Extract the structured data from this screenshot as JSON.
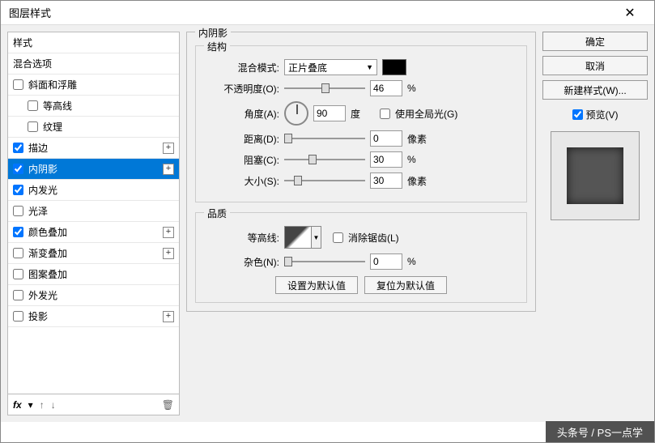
{
  "window": {
    "title": "图层样式"
  },
  "left": {
    "header1": "样式",
    "header2": "混合选项",
    "items": [
      {
        "label": "斜面和浮雕",
        "checked": false,
        "plus": false,
        "indent": 0
      },
      {
        "label": "等高线",
        "checked": false,
        "plus": false,
        "indent": 1
      },
      {
        "label": "纹理",
        "checked": false,
        "plus": false,
        "indent": 1
      },
      {
        "label": "描边",
        "checked": true,
        "plus": true,
        "indent": 0
      },
      {
        "label": "内阴影",
        "checked": true,
        "plus": true,
        "indent": 0,
        "selected": true
      },
      {
        "label": "内发光",
        "checked": true,
        "plus": false,
        "indent": 0
      },
      {
        "label": "光泽",
        "checked": false,
        "plus": false,
        "indent": 0
      },
      {
        "label": "颜色叠加",
        "checked": true,
        "plus": true,
        "indent": 0
      },
      {
        "label": "渐变叠加",
        "checked": false,
        "plus": true,
        "indent": 0
      },
      {
        "label": "图案叠加",
        "checked": false,
        "plus": false,
        "indent": 0
      },
      {
        "label": "外发光",
        "checked": false,
        "plus": false,
        "indent": 0
      },
      {
        "label": "投影",
        "checked": false,
        "plus": true,
        "indent": 0
      }
    ],
    "fx": "fx"
  },
  "mid": {
    "title": "内阴影",
    "struct_title": "结构",
    "blend_mode_label": "混合模式:",
    "blend_mode_value": "正片叠底",
    "opacity_label": "不透明度(O):",
    "opacity_value": "46",
    "opacity_unit": "%",
    "angle_label": "角度(A):",
    "angle_value": "90",
    "angle_unit": "度",
    "global_light_label": "使用全局光(G)",
    "distance_label": "距离(D):",
    "distance_value": "0",
    "distance_unit": "像素",
    "choke_label": "阻塞(C):",
    "choke_value": "30",
    "choke_unit": "%",
    "size_label": "大小(S):",
    "size_value": "30",
    "size_unit": "像素",
    "quality_title": "品质",
    "contour_label": "等高线:",
    "antialias_label": "消除锯齿(L)",
    "noise_label": "杂色(N):",
    "noise_value": "0",
    "noise_unit": "%",
    "default_btn": "设置为默认值",
    "reset_btn": "复位为默认值"
  },
  "right": {
    "ok": "确定",
    "cancel": "取消",
    "new_style": "新建样式(W)...",
    "preview_label": "预览(V)"
  },
  "watermark": "头条号 / PS一点学"
}
